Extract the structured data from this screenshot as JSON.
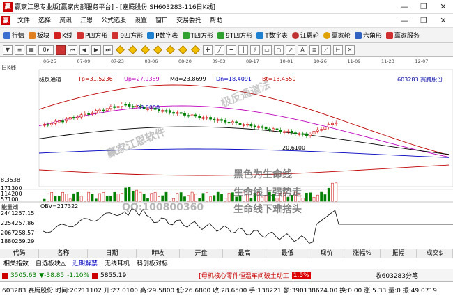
{
  "titlebar": {
    "title": "赢家江恩专业版[赢家内部服务平台] - [嘉腾股份  SH603283-116日K线]",
    "app_icon": "赢"
  },
  "menu": {
    "items": [
      "文件",
      "选择",
      "资讯",
      "江恩",
      "公式选股",
      "设置",
      "窗口",
      "交易委托",
      "帮助"
    ],
    "icon": "赢"
  },
  "toolbar1": {
    "items": [
      "行情",
      "板块",
      "K线",
      "P四方形",
      "9四方形",
      "P数字表",
      "T四方形",
      "9T四方形",
      "T数字表",
      "江恩轮",
      "赢家轮",
      "六角形",
      "赢家服务"
    ]
  },
  "toolbar2": {
    "zoom": "0"
  },
  "chart": {
    "period_label": "日K线",
    "dates": [
      "06-25",
      "07-09",
      "07-23",
      "08-06",
      "08-20",
      "09-03",
      "09-17",
      "10-01",
      "10-26",
      "11-09",
      "11-23",
      "12-07"
    ],
    "indicator_name": "极反通道",
    "tp": "Tp=31.5236",
    "up": "Up=27.9389",
    "md": "Md=23.8699",
    "dn": "Dn=18.4091",
    "bt": "Bt=13.4550",
    "stock": "603283 赛腾股份",
    "high_label": "38.0000",
    "low_label": "20.6100",
    "vol_ticks": [
      "8.3538",
      "171300",
      "114200",
      "57100"
    ],
    "obv_label": "OBV=217322",
    "obv_title": "能量潮",
    "obv_ticks": [
      "2441257.15",
      "2254257.86",
      "2067258.57",
      "1880259.29"
    ]
  },
  "watermarks": {
    "w1": "赢家江恩软件",
    "w2": "极反通道法",
    "w3": "黑色为生命线",
    "w4": "生命线上强势走",
    "w5": "生命线下难捨头",
    "w6": "QQ:100800360"
  },
  "table_header": [
    "代码",
    "名称",
    "日期",
    "昨收",
    "开盘",
    "最高",
    "最低",
    "现价",
    "涨幅%",
    "振幅",
    "成交$"
  ],
  "tabs": [
    "相关指数",
    "自选板块△",
    "近期解禁",
    "无线耳机",
    "科创板对标"
  ],
  "status1": {
    "index1": "3505.63",
    "index1_chg": "▼-38.85",
    "index1_pct": "-1.10%",
    "index2": "5855.19",
    "news": "[母机核心零件恒温车间破土动工",
    "news_pct": "1.5%",
    "right": "收603283分笔"
  },
  "status2": "603283 赛腾股份 时间:20211102 开:27.0100 高:29.5800 低:26.6800 收:28.6500 手:138221 额:390138624.00 换:0.00 涨:5.33 量:0 振:49.0719"
}
